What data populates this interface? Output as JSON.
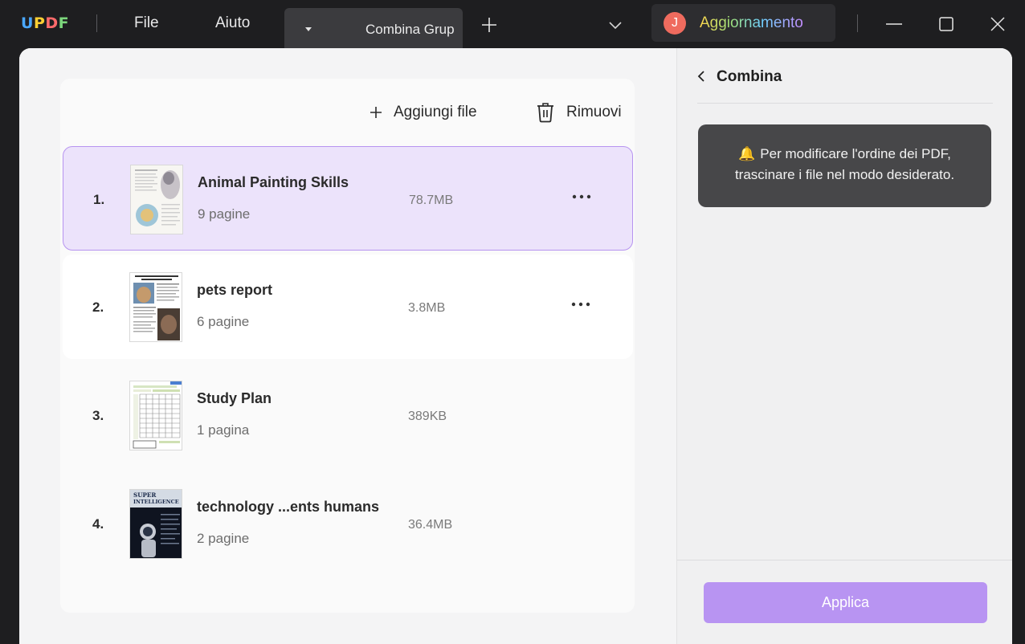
{
  "titlebar": {
    "logo": [
      "U",
      "P",
      "D",
      "F"
    ],
    "menu": [
      "File",
      "Aiuto"
    ],
    "tab_label": "Combina Grup",
    "upgrade_initial": "J",
    "upgrade_label": "Aggiornamento"
  },
  "file_list": {
    "add_label": "Aggiungi file",
    "remove_label": "Rimuovi",
    "files": [
      {
        "index": "1.",
        "name": "Animal Painting Skills",
        "pages": "9 pagine",
        "size": "78.7MB"
      },
      {
        "index": "2.",
        "name": "pets report",
        "pages": "6 pagine",
        "size": "3.8MB"
      },
      {
        "index": "3.",
        "name": "Study Plan",
        "pages": "1 pagina",
        "size": "389KB"
      },
      {
        "index": "4.",
        "name": "technology ...ents humans",
        "pages": "2 pagine",
        "size": "36.4MB"
      }
    ],
    "thumb4_text_line1": "SUPER",
    "thumb4_text_line2": "INTELLIGENCE"
  },
  "panel": {
    "title": "Combina",
    "tip_line1": "Per modificare l'ordine dei PDF,",
    "tip_line2": "trascinare i file nel modo desiderato.",
    "apply_label": "Applica"
  },
  "colors": {
    "accent": "#b894f2",
    "selected_bg": "#ece3fb",
    "selected_border": "#b794f0",
    "avatar": "#ef6b5e"
  }
}
